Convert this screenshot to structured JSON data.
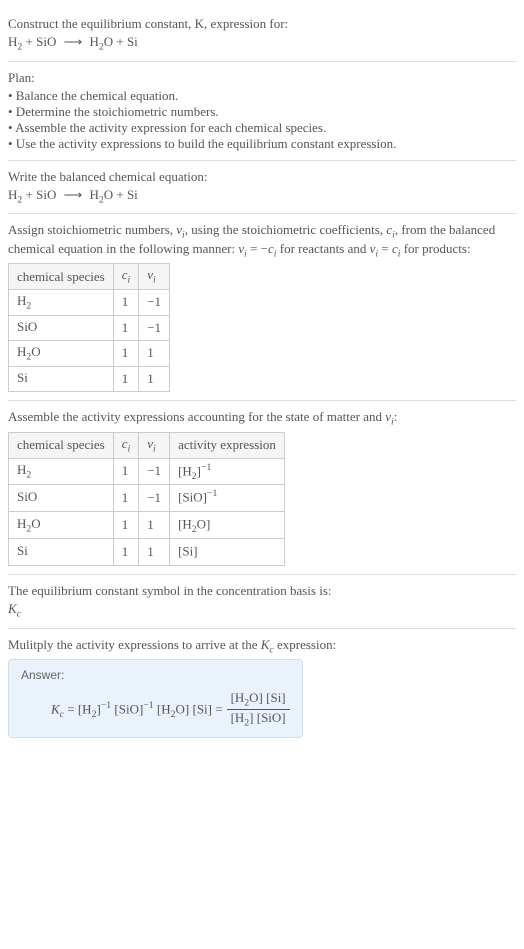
{
  "title": "Construct the equilibrium constant, K, expression for:",
  "main_equation_lhs1": "H",
  "main_equation_sub1": "2",
  "main_equation_plus": " + SiO ",
  "main_equation_arrow": "⟶",
  "main_equation_rhs": " H",
  "main_equation_sub2": "2",
  "main_equation_rhs2": "O + Si",
  "plan_label": "Plan:",
  "plan_items": [
    "• Balance the chemical equation.",
    "• Determine the stoichiometric numbers.",
    "• Assemble the activity expression for each chemical species.",
    "• Use the activity expressions to build the equilibrium constant expression."
  ],
  "balanced_label": "Write the balanced chemical equation:",
  "stoich_intro1": "Assign stoichiometric numbers, ",
  "stoich_nu": "ν",
  "stoich_i": "i",
  "stoich_intro2": ", using the stoichiometric coefficients, ",
  "stoich_c": "c",
  "stoich_intro3": ", from the balanced chemical equation in the following manner: ",
  "stoich_eq1a": "ν",
  "stoich_eq1b": " = −",
  "stoich_eq1c": "c",
  "stoich_intro4": " for reactants and ",
  "stoich_eq2b": " = ",
  "stoich_intro5": " for products:",
  "table1_headers": {
    "species": "chemical species",
    "ci": "c",
    "nui": "ν"
  },
  "table1_rows": [
    {
      "species_pre": "H",
      "species_sub": "2",
      "species_post": "",
      "ci": "1",
      "nui": "−1"
    },
    {
      "species_pre": "SiO",
      "species_sub": "",
      "species_post": "",
      "ci": "1",
      "nui": "−1"
    },
    {
      "species_pre": "H",
      "species_sub": "2",
      "species_post": "O",
      "ci": "1",
      "nui": "1"
    },
    {
      "species_pre": "Si",
      "species_sub": "",
      "species_post": "",
      "ci": "1",
      "nui": "1"
    }
  ],
  "activity_intro1": "Assemble the activity expressions accounting for the state of matter and ",
  "activity_intro2": ":",
  "table2_headers": {
    "species": "chemical species",
    "activity": "activity expression"
  },
  "table2_rows": [
    {
      "species_pre": "H",
      "species_sub": "2",
      "species_post": "",
      "ci": "1",
      "nui": "−1",
      "act_pre": "[H",
      "act_sub": "2",
      "act_post": "]",
      "act_exp": "−1"
    },
    {
      "species_pre": "SiO",
      "species_sub": "",
      "species_post": "",
      "ci": "1",
      "nui": "−1",
      "act_pre": "[SiO]",
      "act_sub": "",
      "act_post": "",
      "act_exp": "−1"
    },
    {
      "species_pre": "H",
      "species_sub": "2",
      "species_post": "O",
      "ci": "1",
      "nui": "1",
      "act_pre": "[H",
      "act_sub": "2",
      "act_post": "O]",
      "act_exp": ""
    },
    {
      "species_pre": "Si",
      "species_sub": "",
      "species_post": "",
      "ci": "1",
      "nui": "1",
      "act_pre": "[Si]",
      "act_sub": "",
      "act_post": "",
      "act_exp": ""
    }
  ],
  "kc_symbol_label": "The equilibrium constant symbol in the concentration basis is:",
  "kc_symbol": "K",
  "kc_sub": "c",
  "multiply_label1": "Mulitply the activity expressions to arrive at the ",
  "multiply_label2": " expression:",
  "answer_label": "Answer:",
  "answer_eq_lhs": "K",
  "answer_terms": {
    "eq": " = ",
    "t1_pre": "[H",
    "t1_sub": "2",
    "t1_post": "]",
    "t1_exp": "−1",
    "t2": " [SiO]",
    "t2_exp": "−1",
    "t3_pre": " [H",
    "t3_sub": "2",
    "t3_post": "O]",
    "t4": " [Si] = "
  },
  "frac_num": {
    "p1": "[H",
    "s1": "2",
    "p2": "O] [Si]"
  },
  "frac_den": {
    "p1": "[H",
    "s1": "2",
    "p2": "] [SiO]"
  }
}
